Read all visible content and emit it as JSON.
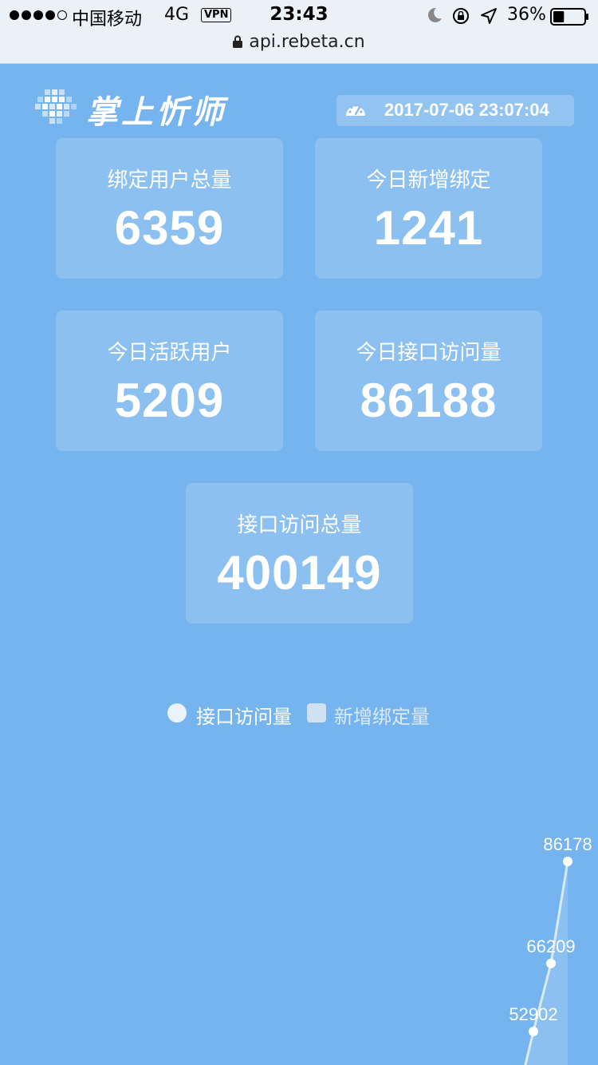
{
  "status_bar": {
    "carrier": "中国移动",
    "network": "4G",
    "vpn": "VPN",
    "time": "23:43",
    "battery": "36%",
    "battery_level": 0.36
  },
  "browser": {
    "url": "api.rebeta.cn"
  },
  "header": {
    "brand": "掌上忻师",
    "timestamp": "2017-07-06 23:07:04",
    "logo_icon": "grid-logo-icon",
    "timestamp_icon": "dashboard-gauge-icon"
  },
  "stats": [
    {
      "label": "绑定用户总量",
      "value": "6359"
    },
    {
      "label": "今日新增绑定",
      "value": "1241"
    },
    {
      "label": "今日活跃用户",
      "value": "5209"
    },
    {
      "label": "今日接口访问量",
      "value": "86188"
    },
    {
      "label": "接口访问总量",
      "value": "400149"
    }
  ],
  "legend": [
    {
      "label": "接口访问量",
      "color": "#eaf3fb",
      "marker": "circle"
    },
    {
      "label": "新增绑定量",
      "color": "#cfe1f3",
      "marker": "square"
    }
  ],
  "chart_data": {
    "type": "line",
    "title": "",
    "series": [
      {
        "name": "接口访问量",
        "values": [
          52902,
          66209,
          86178
        ]
      }
    ],
    "data_labels": [
      "52902",
      "66209",
      "86178"
    ],
    "ylim": [
      0,
      90000
    ],
    "colors": {
      "line": "#d9ebfb",
      "area": "#9ccaf3",
      "point": "#ffffff",
      "label": "#ffffff"
    }
  },
  "colors": {
    "background": "#75b4ee",
    "card": "rgba(255,255,255,0.16)"
  }
}
